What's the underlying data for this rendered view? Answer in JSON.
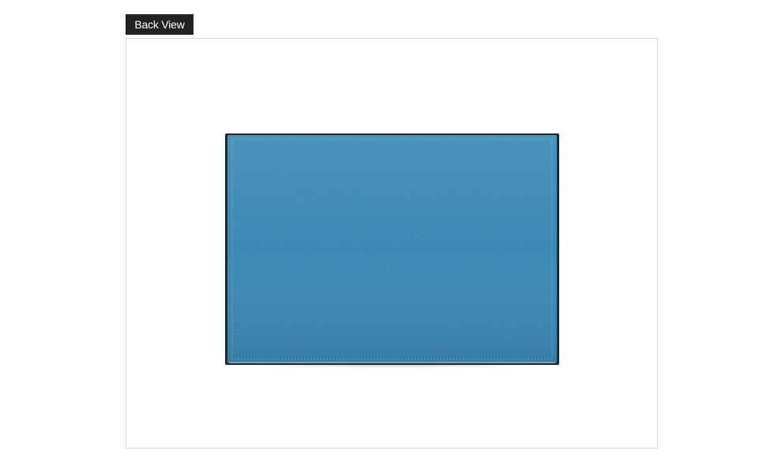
{
  "tag": {
    "label": "Back View"
  },
  "product": {
    "leather_color": "#3a8ab8",
    "edge_color": "#1a2a33"
  }
}
